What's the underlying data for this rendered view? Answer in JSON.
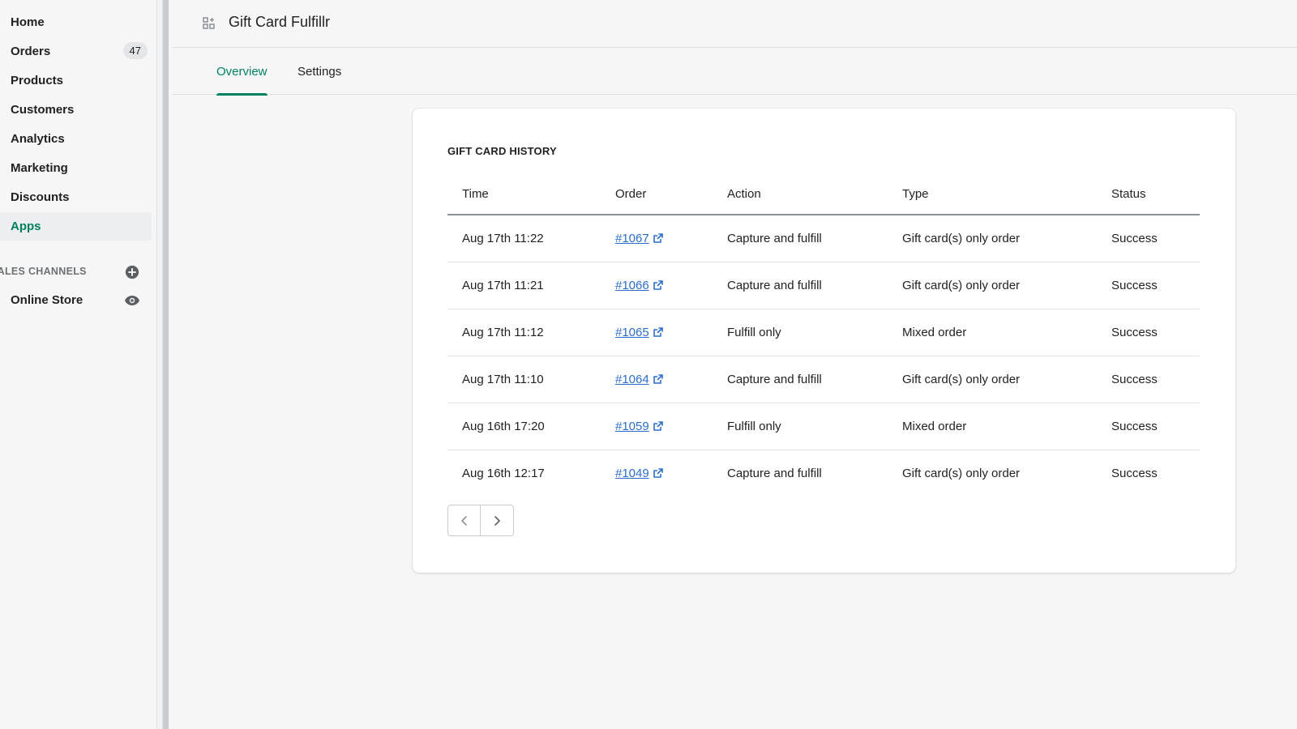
{
  "sidebar": {
    "items": [
      {
        "label": "Home"
      },
      {
        "label": "Orders",
        "badge": "47"
      },
      {
        "label": "Products"
      },
      {
        "label": "Customers"
      },
      {
        "label": "Analytics"
      },
      {
        "label": "Marketing"
      },
      {
        "label": "Discounts"
      },
      {
        "label": "Apps",
        "active": true
      }
    ],
    "channels_heading": "SALES CHANNELS",
    "channels_add_icon": "plus-circle-icon",
    "channels": [
      {
        "label": "Online Store",
        "icon": "eye-icon"
      }
    ]
  },
  "topbar": {
    "app_icon": "apps-icon",
    "title": "Gift Card Fulfillr"
  },
  "tabs": [
    {
      "label": "Overview",
      "active": true
    },
    {
      "label": "Settings",
      "active": false
    }
  ],
  "history": {
    "title": "GIFT CARD HISTORY",
    "columns": [
      "Time",
      "Order",
      "Action",
      "Type",
      "Status"
    ],
    "rows": [
      {
        "time": "Aug 17th 11:22",
        "order": "#1067",
        "action": "Capture and fulfill",
        "type": "Gift card(s) only order",
        "status": "Success"
      },
      {
        "time": "Aug 17th 11:21",
        "order": "#1066",
        "action": "Capture and fulfill",
        "type": "Gift card(s) only order",
        "status": "Success"
      },
      {
        "time": "Aug 17th 11:12",
        "order": "#1065",
        "action": "Fulfill only",
        "type": "Mixed order",
        "status": "Success"
      },
      {
        "time": "Aug 17th 11:10",
        "order": "#1064",
        "action": "Capture and fulfill",
        "type": "Gift card(s) only order",
        "status": "Success"
      },
      {
        "time": "Aug 16th 17:20",
        "order": "#1059",
        "action": "Fulfill only",
        "type": "Mixed order",
        "status": "Success"
      },
      {
        "time": "Aug 16th 12:17",
        "order": "#1049",
        "action": "Capture and fulfill",
        "type": "Gift card(s) only order",
        "status": "Success"
      }
    ],
    "pagination": {
      "prev_icon": "chevron-left-icon",
      "next_icon": "chevron-right-icon"
    }
  },
  "colors": {
    "accent": "#008060",
    "link": "#2c6ecb",
    "background": "#f6f6f7"
  }
}
